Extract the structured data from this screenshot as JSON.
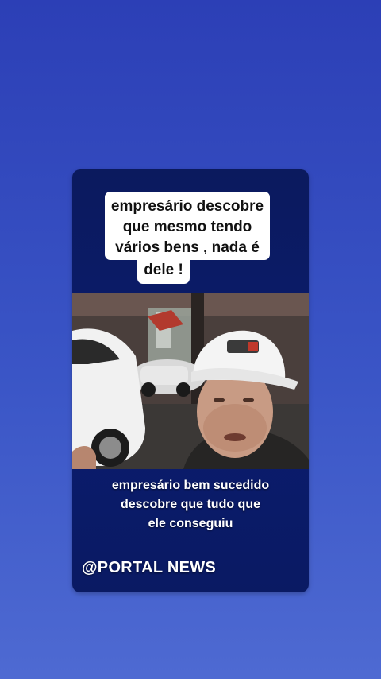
{
  "card": {
    "headline": {
      "line1": "empresário  descobre",
      "line2": "que mesmo tendo",
      "line3": "vários bens , nada é",
      "line4": "dele !"
    },
    "subtitle": {
      "line1": "empresário bem sucedido",
      "line2": "descobre que tudo que",
      "line3": "ele conseguiu"
    },
    "brand": "@PORTAL NEWS",
    "photo": {
      "description_icon": "video-frame"
    }
  },
  "colors": {
    "background_top": "#2c3fb6",
    "background_bottom": "#4e6ad2",
    "card": "#0b1a5e",
    "caption_bg": "#ffffff"
  }
}
